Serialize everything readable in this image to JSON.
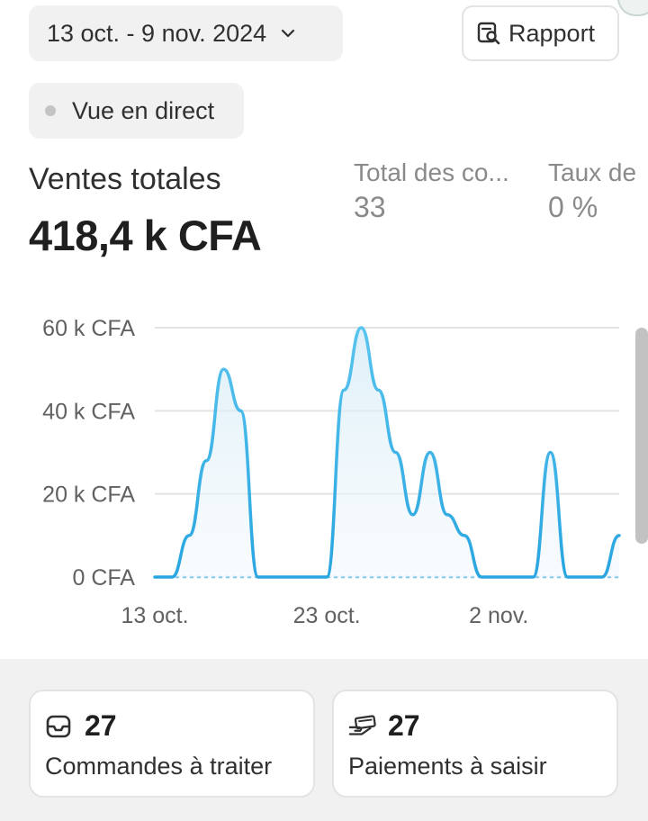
{
  "toolbar": {
    "date_range_label": "13 oct. - 9 nov. 2024",
    "report_label": "Rapport",
    "live_label": "Vue en direct"
  },
  "metrics": {
    "total_sales_label": "Ventes totales",
    "total_sales_value": "418,4 k CFA",
    "orders_label": "Total des co...",
    "orders_value": "33",
    "rate_label": "Taux de",
    "rate_value": "0 %"
  },
  "colors": {
    "line": "#29a5e0",
    "comparison": "#7fc4e8",
    "accent_muted": "#8a8a8a"
  },
  "chart_data": {
    "type": "area",
    "ylabel_ticks": [
      "0 CFA",
      "20 k CFA",
      "40 k CFA",
      "60 k CFA"
    ],
    "ylim": [
      0,
      60000
    ],
    "xtick_labels": [
      "13 oct.",
      "23 oct.",
      "2 nov."
    ],
    "xtick_index": [
      0,
      10,
      20
    ],
    "grid": true,
    "series": [
      {
        "values": [
          0,
          0,
          10000,
          28000,
          50000,
          40000,
          0,
          0,
          0,
          0,
          0,
          45000,
          60000,
          45000,
          30000,
          15000,
          30000,
          15000,
          10000,
          0,
          0,
          0,
          0,
          30000,
          0,
          0,
          0,
          10000
        ]
      }
    ],
    "comparison_baseline": 0
  },
  "cards": [
    {
      "icon": "inbox-icon",
      "value": "27",
      "label": "Commandes à traiter"
    },
    {
      "icon": "payment-hand-icon",
      "value": "27",
      "label": "Paiements à saisir"
    }
  ]
}
